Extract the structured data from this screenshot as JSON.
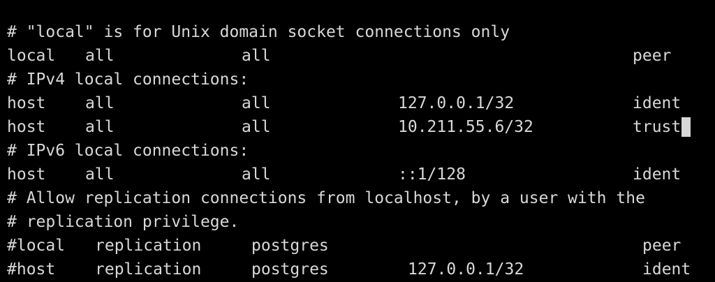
{
  "terminal": {
    "colors": {
      "background": "#000000",
      "foreground": "#d8d8d8",
      "cursor": "#d8d8d8"
    },
    "lines": [
      {
        "comment": "# \"local\" is for Unix domain socket connections only"
      },
      {
        "type": "local",
        "database": "all",
        "user": "all",
        "address": "",
        "method": "peer"
      },
      {
        "comment": "# IPv4 local connections:"
      },
      {
        "type": "host",
        "database": "all",
        "user": "all",
        "address": "127.0.0.1/32",
        "method": "ident"
      },
      {
        "type": "host",
        "database": "all",
        "user": "all",
        "address": "10.211.55.6/32",
        "method": "trust"
      },
      {
        "comment": "# IPv6 local connections:"
      },
      {
        "type": "host",
        "database": "all",
        "user": "all",
        "address": "::1/128",
        "method": "ident"
      },
      {
        "comment": "# Allow replication connections from localhost, by a user with the"
      },
      {
        "comment": "# replication privilege."
      },
      {
        "type": "#local",
        "database": "replication",
        "user": "postgres",
        "address": "",
        "method": "peer"
      },
      {
        "type": "#host",
        "database": "replication",
        "user": "postgres",
        "address": "127.0.0.1/32",
        "method": "ident"
      }
    ]
  }
}
